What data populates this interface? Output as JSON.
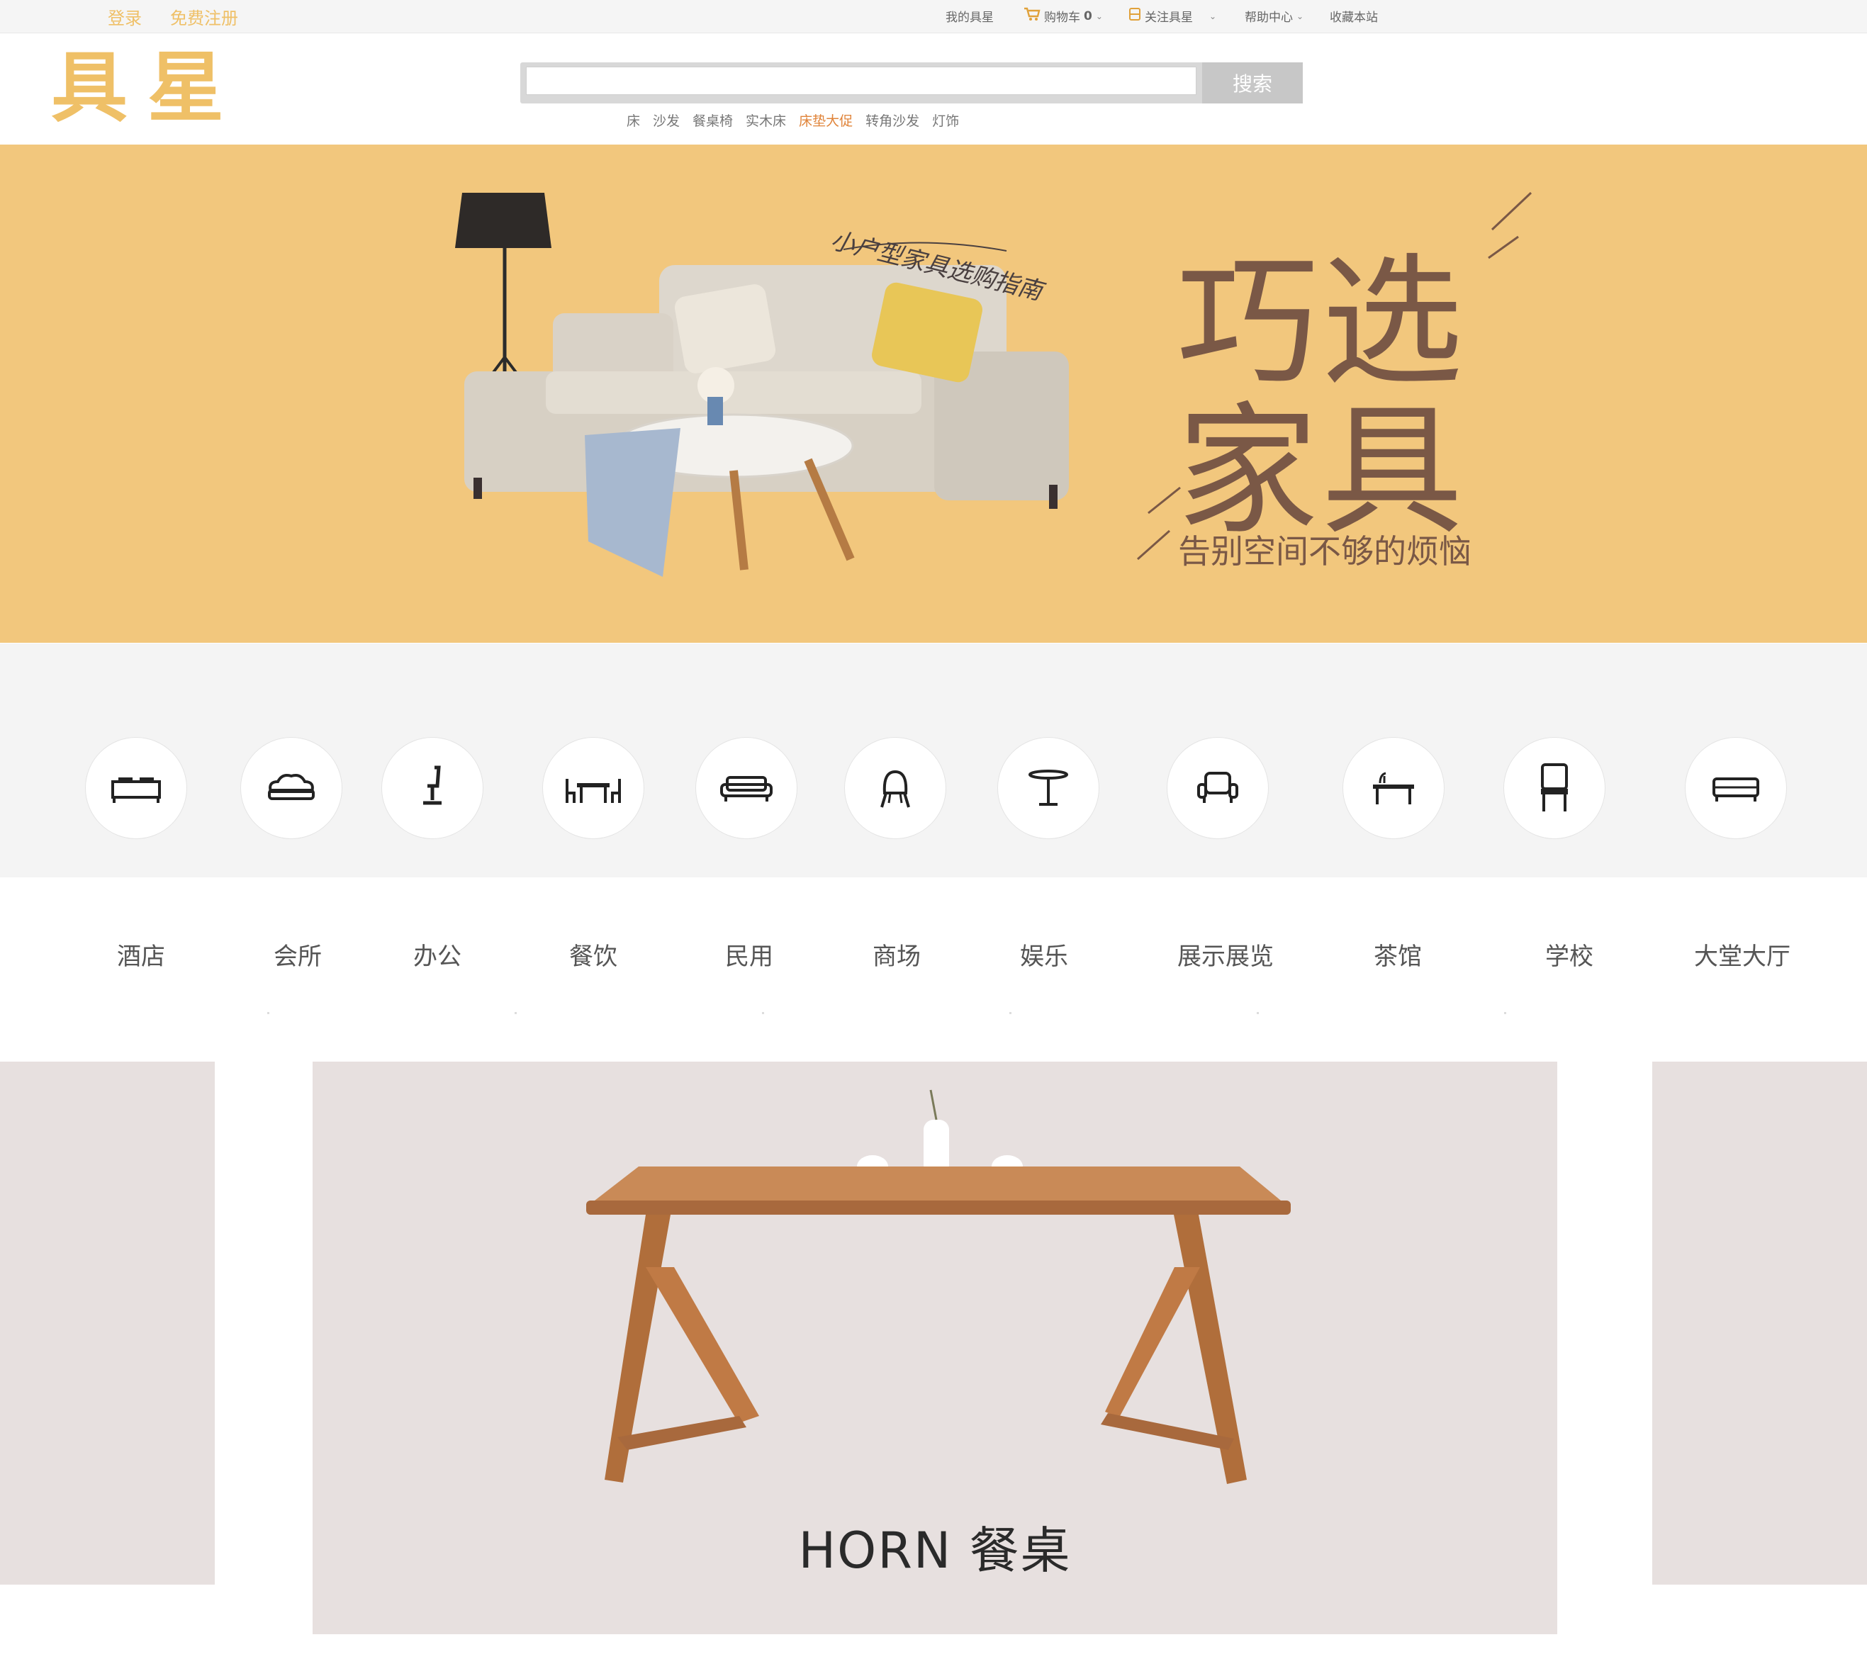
{
  "topbar": {
    "login": "登录",
    "register": "免费注册",
    "my_account": "我的具星",
    "cart_label": "购物车",
    "cart_count": "0",
    "follow": "关注具星",
    "help_center": "帮助中心",
    "bookmark": "收藏本站"
  },
  "header": {
    "logo": "具星",
    "search_placeholder": "",
    "search_button": "搜索",
    "hot_words": [
      "床",
      "沙发",
      "餐桌椅",
      "实木床",
      "床垫大促",
      "转角沙发",
      "灯饰"
    ],
    "hot_highlight_index": 4
  },
  "banner": {
    "handwritten": "小户型家具选购指南",
    "headline_1": "巧选",
    "headline_2": "家具",
    "subtitle": "告别空间不够的烦恼",
    "background_color": "#f2c77d",
    "headline_color": "#7a5846"
  },
  "categories": {
    "icons": [
      "bed-icon",
      "sofa-icon",
      "office-chair-icon",
      "dining-set-icon",
      "couch-icon",
      "shell-chair-icon",
      "round-table-icon",
      "armchair-icon",
      "tea-table-icon",
      "chair-icon",
      "loveseat-icon"
    ],
    "labels": [
      "酒店",
      "会所",
      "办公",
      "餐饮",
      "民用",
      "商场",
      "娱乐",
      "展示展览",
      "茶馆",
      "学校",
      "大堂大厅"
    ]
  },
  "product": {
    "title": "HORN 餐桌"
  },
  "colors": {
    "brand": "#efc067",
    "accent_hot": "#e0843a",
    "page_gray": "#f4f4f4",
    "product_bg": "#e7e0df"
  }
}
